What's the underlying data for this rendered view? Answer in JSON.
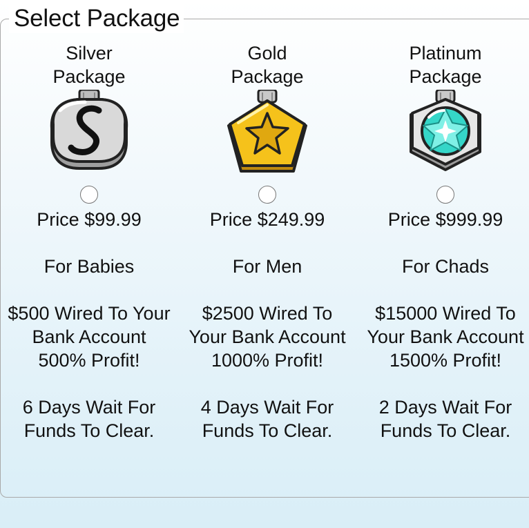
{
  "section": {
    "legend": "Select Package"
  },
  "packages": [
    {
      "name_line1": "Silver",
      "name_line2": "Package",
      "badge_icon": "silver-medal-icon",
      "price": "Price $99.99",
      "audience": "For Babies",
      "offer_line1": "$500 Wired To Your",
      "offer_line2": "Bank Account",
      "offer_line3": "500% Profit!",
      "wait_line1": "6 Days Wait For",
      "wait_line2": "Funds To Clear.",
      "selected": false
    },
    {
      "name_line1": "Gold",
      "name_line2": "Package",
      "badge_icon": "gold-medal-icon",
      "price": "Price $249.99",
      "audience": "For Men",
      "offer_line1": "$2500 Wired To",
      "offer_line2": "Your Bank Account",
      "offer_line3": "1000% Profit!",
      "wait_line1": "4 Days Wait For",
      "wait_line2": "Funds To Clear.",
      "selected": false
    },
    {
      "name_line1": "Platinum",
      "name_line2": "Package",
      "badge_icon": "platinum-medal-icon",
      "price": "Price $999.99",
      "audience": "For Chads",
      "offer_line1": "$15000 Wired To",
      "offer_line2": "Your Bank Account",
      "offer_line3": "1500% Profit!",
      "wait_line1": "2 Days Wait For",
      "wait_line2": "Funds To Clear.",
      "selected": false
    }
  ],
  "colors": {
    "border": "#a9a9a9",
    "silver": "#cfcfcf",
    "gold": "#f5c21b",
    "platinum_gem": "#35d6c8"
  }
}
